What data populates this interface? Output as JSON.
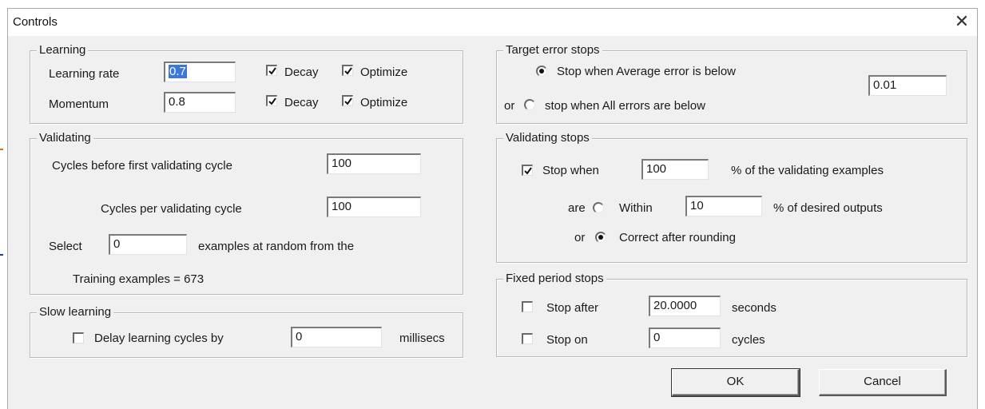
{
  "window": {
    "title": "Controls",
    "close_icon": "close-icon"
  },
  "learning": {
    "legend": "Learning",
    "rate_label": "Learning rate",
    "rate_value": "0.7",
    "momentum_label": "Momentum",
    "momentum_value": "0.8",
    "decay_label": "Decay",
    "optimize_label": "Optimize",
    "rate_decay_checked": true,
    "rate_optimize_checked": true,
    "momentum_decay_checked": true,
    "momentum_optimize_checked": true
  },
  "validating": {
    "legend": "Validating",
    "first_cycle_label": "Cycles before first validating cycle",
    "first_cycle_value": "100",
    "per_cycle_label": "Cycles per validating cycle",
    "per_cycle_value": "100",
    "select_label": "Select",
    "select_value": "0",
    "select_suffix": "examples at random from the",
    "training_examples": "Training examples = 673"
  },
  "slow_learning": {
    "legend": "Slow learning",
    "delay_label": "Delay learning cycles by",
    "delay_value": "0",
    "delay_unit": "millisecs",
    "delay_checked": false
  },
  "target_error": {
    "legend": "Target error stops",
    "average_label": "Stop when Average error is below",
    "or_label": "or",
    "all_label": "stop when All errors are below",
    "error_value": "0.01",
    "selected": "average"
  },
  "validating_stops": {
    "legend": "Validating stops",
    "stop_when_label": "Stop when",
    "stop_when_value": "100",
    "stop_when_suffix": "% of the validating examples",
    "stop_when_checked": true,
    "are_label": "are",
    "within_label": "Within",
    "within_value": "10",
    "within_suffix": "% of desired outputs",
    "or_label": "or",
    "correct_label": "Correct after rounding",
    "selected": "correct"
  },
  "fixed_period": {
    "legend": "Fixed period stops",
    "stop_after_label": "Stop after",
    "stop_after_value": "20.0000",
    "stop_after_unit": "seconds",
    "stop_after_checked": false,
    "stop_on_label": "Stop on",
    "stop_on_value": "0",
    "stop_on_unit": "cycles",
    "stop_on_checked": false
  },
  "buttons": {
    "ok": "OK",
    "cancel": "Cancel"
  }
}
